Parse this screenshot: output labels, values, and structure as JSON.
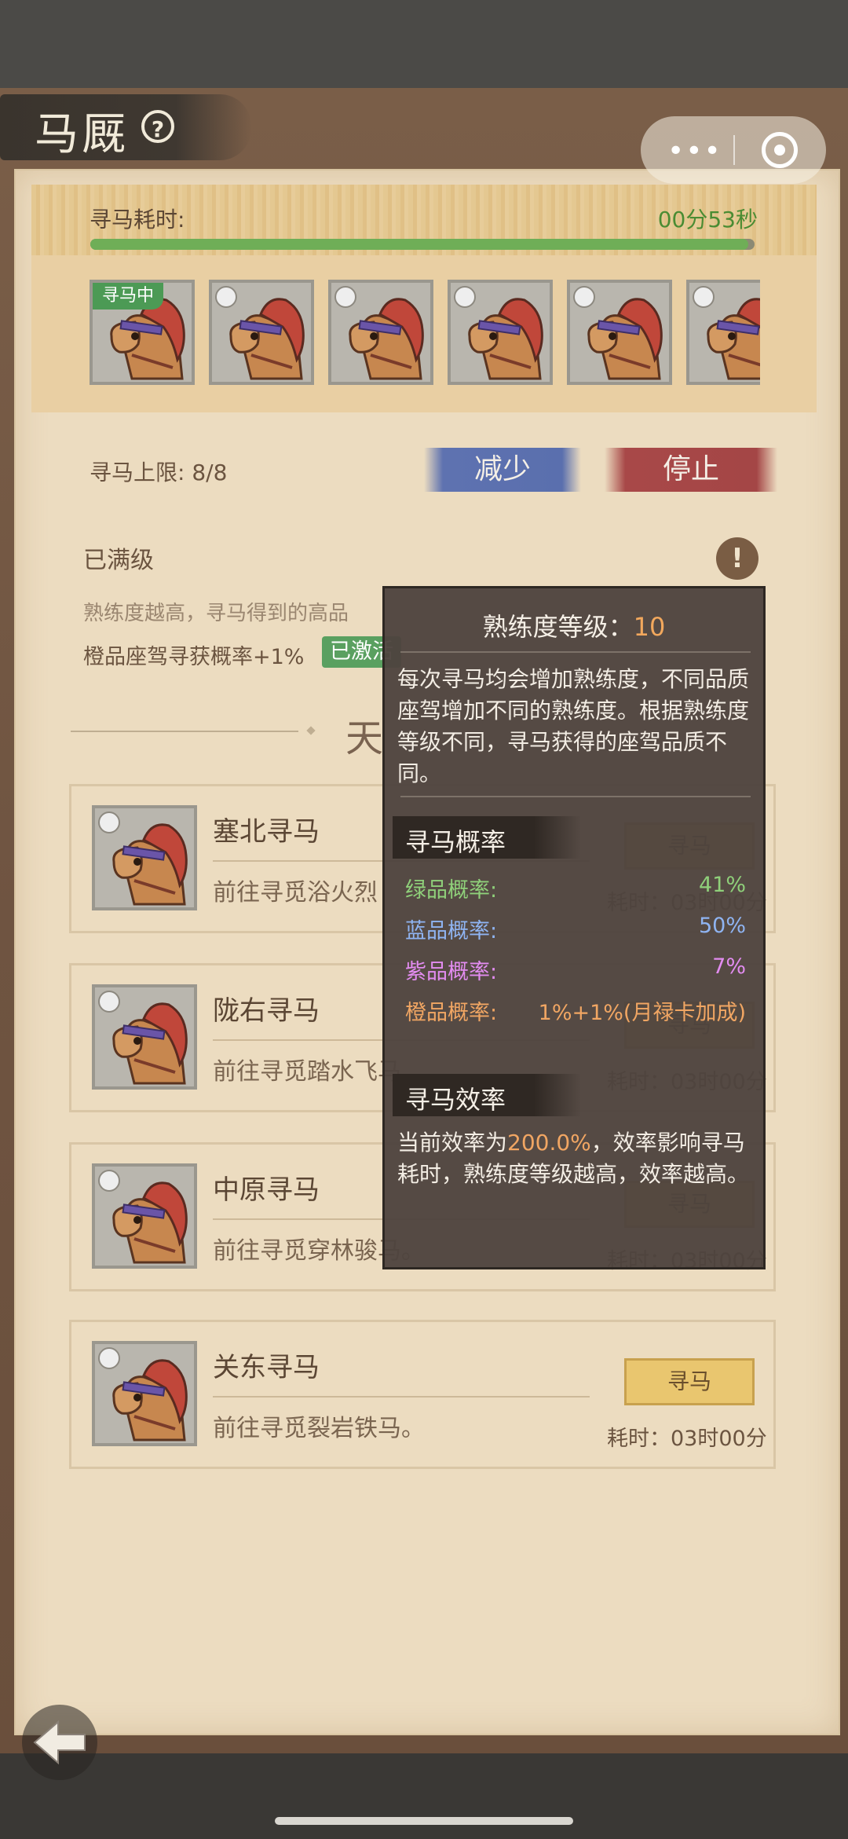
{
  "header": {
    "title": "马厩",
    "help": "?"
  },
  "capsule": {
    "more": "•••"
  },
  "timer": {
    "label": "寻马耗时:",
    "value": "00分53秒",
    "progress": 0.99
  },
  "slots": [
    {
      "tag": "寻马中"
    },
    {
      "tag": ""
    },
    {
      "tag": ""
    },
    {
      "tag": ""
    },
    {
      "tag": ""
    },
    {
      "tag": ""
    }
  ],
  "limit": {
    "label": "寻马上限:",
    "value": "8/8",
    "reduce": "减少",
    "stop": "停止"
  },
  "proficiency": {
    "status": "已满级",
    "info": "!",
    "desc": "熟练度越高，寻马得到的高品",
    "bonus": "橙品座驾寻获概率+1%",
    "activated": "已激活"
  },
  "section": {
    "title": "天"
  },
  "cards": [
    {
      "title": "塞北寻马",
      "desc": "前往寻觅浴火烈",
      "button": "寻马",
      "time": "耗时：03时00分"
    },
    {
      "title": "陇右寻马",
      "desc": "前往寻觅踏水飞马",
      "button": "寻马",
      "time": "耗时：03时00分"
    },
    {
      "title": "中原寻马",
      "desc": "前往寻觅穿林骏马。",
      "button": "寻马",
      "time": "耗时：03时00分"
    },
    {
      "title": "关东寻马",
      "desc": "前往寻觅裂岩铁马。",
      "button": "寻马",
      "time": "耗时：03时00分"
    }
  ],
  "popup": {
    "title": "熟练度等级：",
    "level": "10",
    "desc": "每次寻马均会增加熟练度，不同品质座驾增加不同的熟练度。根据熟练度等级不同，寻马获得的座驾品质不同。",
    "rates_heading": "寻马概率",
    "rates": [
      {
        "label": "绿品概率:",
        "value": "41%",
        "color": "green"
      },
      {
        "label": "蓝品概率:",
        "value": "50%",
        "color": "blue"
      },
      {
        "label": "紫品概率:",
        "value": "7%",
        "color": "purple"
      },
      {
        "label": "橙品概率:",
        "value": "1%+1%(月禄卡加成)",
        "color": "orange"
      }
    ],
    "eff_heading": "寻马效率",
    "eff_prefix": "当前效率为",
    "eff_value": "200.0%",
    "eff_suffix": "，效率影响寻马耗时，熟练度等级越高，效率越高。"
  }
}
